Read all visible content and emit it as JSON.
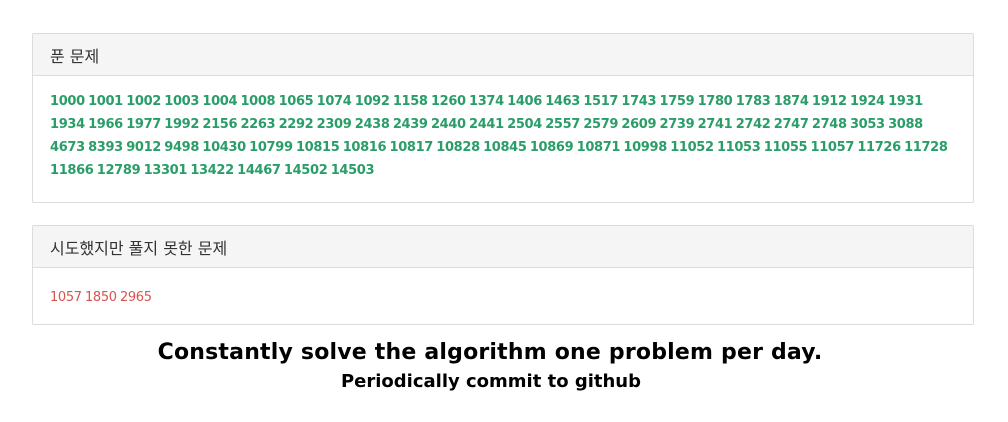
{
  "solved": {
    "title": "푼 문제",
    "problems": [
      "1000",
      "1001",
      "1002",
      "1003",
      "1004",
      "1008",
      "1065",
      "1074",
      "1092",
      "1158",
      "1260",
      "1374",
      "1406",
      "1463",
      "1517",
      "1743",
      "1759",
      "1780",
      "1783",
      "1874",
      "1912",
      "1924",
      "1931",
      "1934",
      "1966",
      "1977",
      "1992",
      "2156",
      "2263",
      "2292",
      "2309",
      "2438",
      "2439",
      "2440",
      "2441",
      "2504",
      "2557",
      "2579",
      "2609",
      "2739",
      "2741",
      "2742",
      "2747",
      "2748",
      "3053",
      "3088",
      "4673",
      "8393",
      "9012",
      "9498",
      "10430",
      "10799",
      "10815",
      "10816",
      "10817",
      "10828",
      "10845",
      "10869",
      "10871",
      "10998",
      "11052",
      "11053",
      "11055",
      "11057",
      "11726",
      "11728",
      "11866",
      "12789",
      "13301",
      "13422",
      "14467",
      "14502",
      "14503"
    ],
    "color": "#2a9d68"
  },
  "failed": {
    "title": "시도했지만 풀지 못한 문제",
    "problems": [
      "1057",
      "1850",
      "2965"
    ],
    "color": "#d9534f"
  },
  "caption": {
    "main": "Constantly solve the algorithm one problem per day.",
    "sub": "Periodically commit to github"
  }
}
